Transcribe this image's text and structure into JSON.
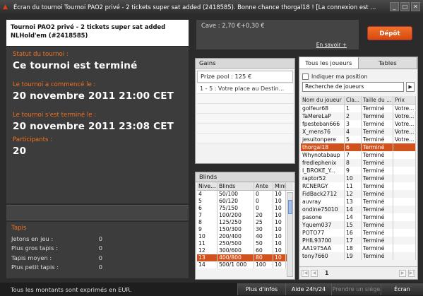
{
  "window": {
    "title": "Écran du tournoi Tournoi PAO2 privé - 2 tickets super sat added (2418585). Bonne chance thorgal18 ! [La connexion est ...",
    "buttons": [
      "_",
      "□",
      "✕"
    ]
  },
  "tournament": {
    "heading_line1": "Tournoi PAO2 privé - 2 tickets super sat added",
    "heading_line2": "NLHold'em (#2418585)",
    "status_label": "Statut du tournoi :",
    "status_value": "Ce tournoi est terminé",
    "started_label": "Le tournoi a commencé le :",
    "started_value": "20 novembre 2011   21:00 CET",
    "ended_label": "Le tournoi s'est terminé le :",
    "ended_value": "20 novembre 2011   23:08 CET",
    "participants_label": "Participants :",
    "participants_value": "20"
  },
  "stacks": {
    "title": "Tapis",
    "rows": [
      {
        "label": "Jetons en jeu :",
        "value": "0"
      },
      {
        "label": "Plus gros tapis :",
        "value": "0"
      },
      {
        "label": "Tapis moyen :",
        "value": "0"
      },
      {
        "label": "Plus petit tapis :",
        "value": "0"
      }
    ]
  },
  "cashier": {
    "text": "Cave : 2,70 €+0,30 €",
    "more_link": "En savoir +",
    "deposit_button": "Dépôt"
  },
  "gains": {
    "title": "Gains",
    "prize_pool": "Prize pool : 125 €",
    "rows": [
      "1 - 5 : Votre place au Destin..."
    ]
  },
  "blinds": {
    "title": "Blinds",
    "headers": [
      "Nive...",
      "Blinds",
      "Ante",
      "Mini"
    ],
    "rows": [
      [
        "4",
        "50/100",
        "0",
        "10"
      ],
      [
        "5",
        "60/120",
        "0",
        "10"
      ],
      [
        "6",
        "75/150",
        "0",
        "10"
      ],
      [
        "7",
        "100/200",
        "20",
        "10"
      ],
      [
        "8",
        "125/250",
        "25",
        "10"
      ],
      [
        "9",
        "150/300",
        "30",
        "10"
      ],
      [
        "10",
        "200/400",
        "40",
        "10"
      ],
      [
        "11",
        "250/500",
        "50",
        "10"
      ],
      [
        "12",
        "300/600",
        "60",
        "10"
      ],
      [
        "13",
        "400/800",
        "80",
        "10"
      ],
      [
        "14",
        "500/1 000",
        "100",
        "10"
      ]
    ],
    "selected_index": 9
  },
  "players": {
    "tab_players": "Tous les joueurs",
    "tab_tables": "Tables",
    "show_position_label": "Indiquer ma position",
    "search_value": "Recherche de joueurs",
    "search_go": "▶",
    "headers": [
      "Nom du joueur",
      "Cla...",
      "Taille du ...",
      "Prix"
    ],
    "rows": [
      [
        "golfeur68",
        "1",
        "Terminé",
        "Votre..."
      ],
      [
        "TaMereLaP",
        "2",
        "Terminé",
        "Votre..."
      ],
      [
        "fpesteban666",
        "3",
        "Terminé",
        "Votre..."
      ],
      [
        "X_mens76",
        "4",
        "Terminé",
        "Votre..."
      ],
      [
        "jesuitonpere",
        "5",
        "Terminé",
        "Votre..."
      ],
      [
        "thorgal18",
        "6",
        "Terminé",
        ""
      ],
      [
        "Whynotabaup",
        "7",
        "Terminé",
        ""
      ],
      [
        "fredlephenix",
        "8",
        "Terminé",
        ""
      ],
      [
        "I_BROKE_Y...",
        "9",
        "Terminé",
        ""
      ],
      [
        "raptor52",
        "10",
        "Terminé",
        ""
      ],
      [
        "RCNERGY",
        "11",
        "Terminé",
        ""
      ],
      [
        "FidBack2712",
        "12",
        "Terminé",
        ""
      ],
      [
        "auvray",
        "13",
        "Terminé",
        ""
      ],
      [
        "ondine75010",
        "14",
        "Terminé",
        ""
      ],
      [
        "pasone",
        "14",
        "Terminé",
        ""
      ],
      [
        "Yquem037",
        "15",
        "Terminé",
        ""
      ],
      [
        "POTO77",
        "16",
        "Terminé",
        ""
      ],
      [
        "PHIL93700",
        "17",
        "Terminé",
        ""
      ],
      [
        "AA1975AA",
        "18",
        "Terminé",
        ""
      ],
      [
        "tony7660",
        "19",
        "Terminé",
        ""
      ]
    ],
    "selected_index": 5,
    "page": "1"
  },
  "bottom": {
    "note": "Tous les montants sont exprimés en EUR.",
    "btn_info": "Plus d'infos",
    "btn_help": "Aide 24h/24",
    "btn_seat": "Prendre un siège",
    "btn_screen": "Écran"
  }
}
